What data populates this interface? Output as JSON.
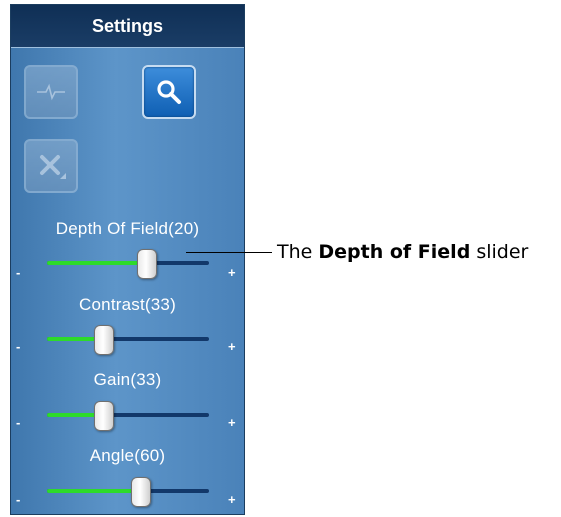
{
  "panel": {
    "title": "Settings",
    "tools": [
      {
        "icon": "waveform-icon",
        "state": "disabled"
      },
      {
        "icon": "search-icon",
        "state": "active"
      },
      {
        "icon": "tools-icon",
        "state": "disabled"
      }
    ]
  },
  "sliders": [
    {
      "name": "depth-of-field",
      "label": "Depth Of Field(20)",
      "value_fraction": 0.62,
      "minus": "-",
      "plus": "+"
    },
    {
      "name": "contrast",
      "label": "Contrast(33)",
      "value_fraction": 0.35,
      "minus": "-",
      "plus": "+"
    },
    {
      "name": "gain",
      "label": "Gain(33)",
      "value_fraction": 0.35,
      "minus": "-",
      "plus": "+"
    },
    {
      "name": "angle",
      "label": "Angle(60)",
      "value_fraction": 0.58,
      "minus": "-",
      "plus": "+"
    }
  ],
  "callout": {
    "prefix": "The ",
    "bold": "Depth of Field",
    "suffix": " slider"
  },
  "colors": {
    "panel_bg": "#4a82b9",
    "header_bg": "#0f2f55",
    "track": "#12386a",
    "track_fill": "#2ddb2a",
    "active_button": "#1f73c9"
  }
}
